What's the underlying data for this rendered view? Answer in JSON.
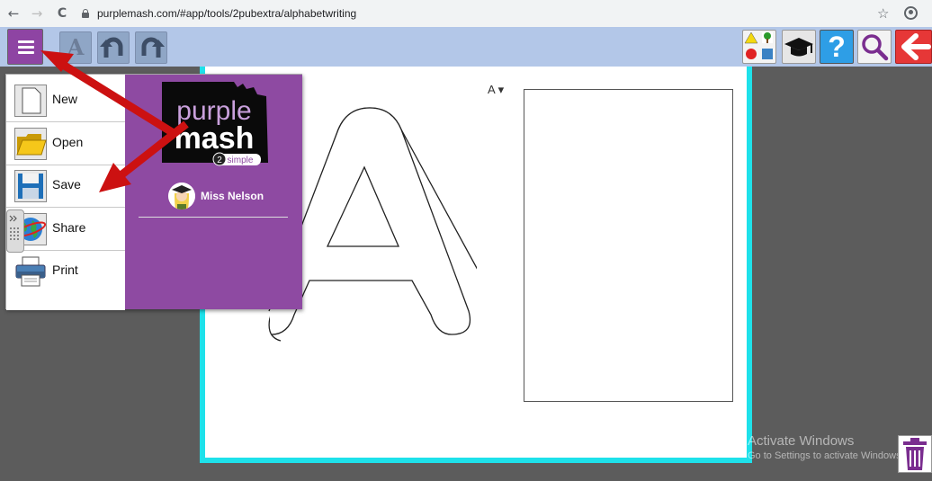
{
  "browser": {
    "back": "←",
    "forward": "→",
    "reload": "C",
    "url": "purplemash.com/#app/tools/2pubextra/alphabetwriting",
    "star": "☆"
  },
  "toolbar": {
    "font_label": "A",
    "help_label": "?"
  },
  "canvas": {
    "letter_dropdown": "A ▾"
  },
  "menu": {
    "items": [
      {
        "label": "New",
        "icon": "new-document-icon"
      },
      {
        "label": "Open",
        "icon": "open-folder-icon"
      },
      {
        "label": "Save",
        "icon": "save-disk-icon"
      },
      {
        "label": "Share",
        "icon": "globe-icon"
      },
      {
        "label": "Print",
        "icon": "printer-icon"
      }
    ],
    "logo": {
      "word1": "purple",
      "word2": "mash",
      "badge_num": "2",
      "badge_text": "simple"
    },
    "user_name": "Miss Nelson"
  },
  "watermark": {
    "title": "Activate Windows",
    "subtitle": "Go to Settings to activate Windows."
  },
  "colors": {
    "toolbar": "#b3c7e8",
    "menu_purple": "#8e4aa2",
    "canvas_border": "#1ee1ea",
    "annotation_arrow": "#cc1111"
  }
}
